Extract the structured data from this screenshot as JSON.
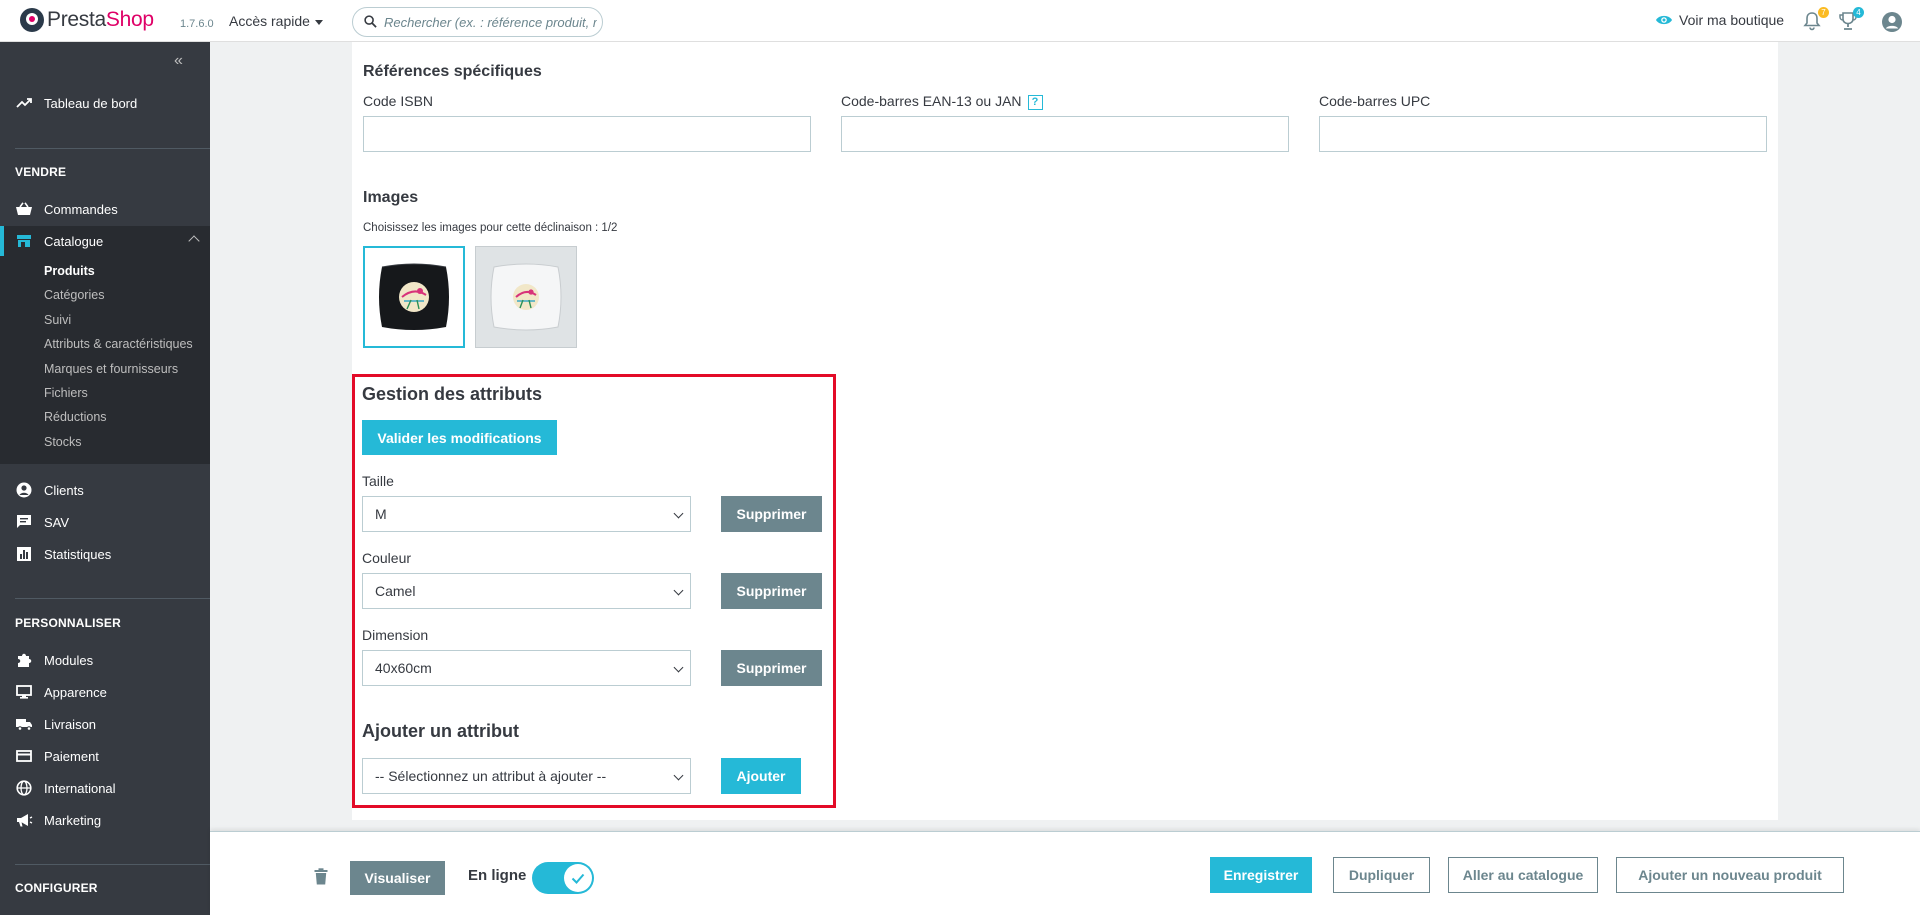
{
  "header": {
    "logo_prefix": "Presta",
    "logo_suffix": "Shop",
    "version": "1.7.6.0",
    "quick_access": "Accès rapide",
    "search_placeholder": "Rechercher (ex. : référence produit, nom",
    "view_shop": "Voir ma boutique",
    "notifications_count": "7",
    "trophies_count": "4",
    "colors": {
      "brand": "#df0067",
      "accent": "#25b9d7",
      "badge_orange": "#fbbb22"
    }
  },
  "sidebar": {
    "dashboard": "Tableau de bord",
    "sections": {
      "sell": "VENDRE",
      "customize": "PERSONNALISER",
      "configure": "CONFIGURER"
    },
    "sell_items": {
      "orders": "Commandes",
      "catalog": "Catalogue",
      "clients": "Clients",
      "sav": "SAV",
      "stats": "Statistiques"
    },
    "catalog_sub": [
      "Produits",
      "Catégories",
      "Suivi",
      "Attributs & caractéristiques",
      "Marques et fournisseurs",
      "Fichiers",
      "Réductions",
      "Stocks"
    ],
    "customize_items": {
      "modules": "Modules",
      "appearance": "Apparence",
      "shipping": "Livraison",
      "payment": "Paiement",
      "international": "International",
      "marketing": "Marketing"
    }
  },
  "refs": {
    "title": "Références spécifiques",
    "isbn_label": "Code ISBN",
    "ean_label": "Code-barres EAN-13 ou JAN",
    "ean_help": "?",
    "upc_label": "Code-barres UPC",
    "isbn_value": "",
    "ean_value": "",
    "upc_value": ""
  },
  "images": {
    "title": "Images",
    "hint": "Choisissez les images pour cette déclinaison : 1/2",
    "thumbs": [
      {
        "name": "black-pillow",
        "selected": true
      },
      {
        "name": "white-pillow",
        "selected": false
      }
    ]
  },
  "attributes": {
    "title": "Gestion des attributs",
    "validate_label": "Valider les modifications",
    "rows": [
      {
        "label": "Taille",
        "value": "M",
        "delete": "Supprimer"
      },
      {
        "label": "Couleur",
        "value": "Camel",
        "delete": "Supprimer"
      },
      {
        "label": "Dimension",
        "value": "40x60cm",
        "delete": "Supprimer"
      }
    ],
    "add_title": "Ajouter un attribut",
    "add_select": "-- Sélectionnez un attribut à ajouter --",
    "add_button": "Ajouter"
  },
  "footer": {
    "preview": "Visualiser",
    "online": "En ligne",
    "save": "Enregistrer",
    "duplicate": "Dupliquer",
    "to_catalog": "Aller au catalogue",
    "new_product": "Ajouter un nouveau produit"
  }
}
